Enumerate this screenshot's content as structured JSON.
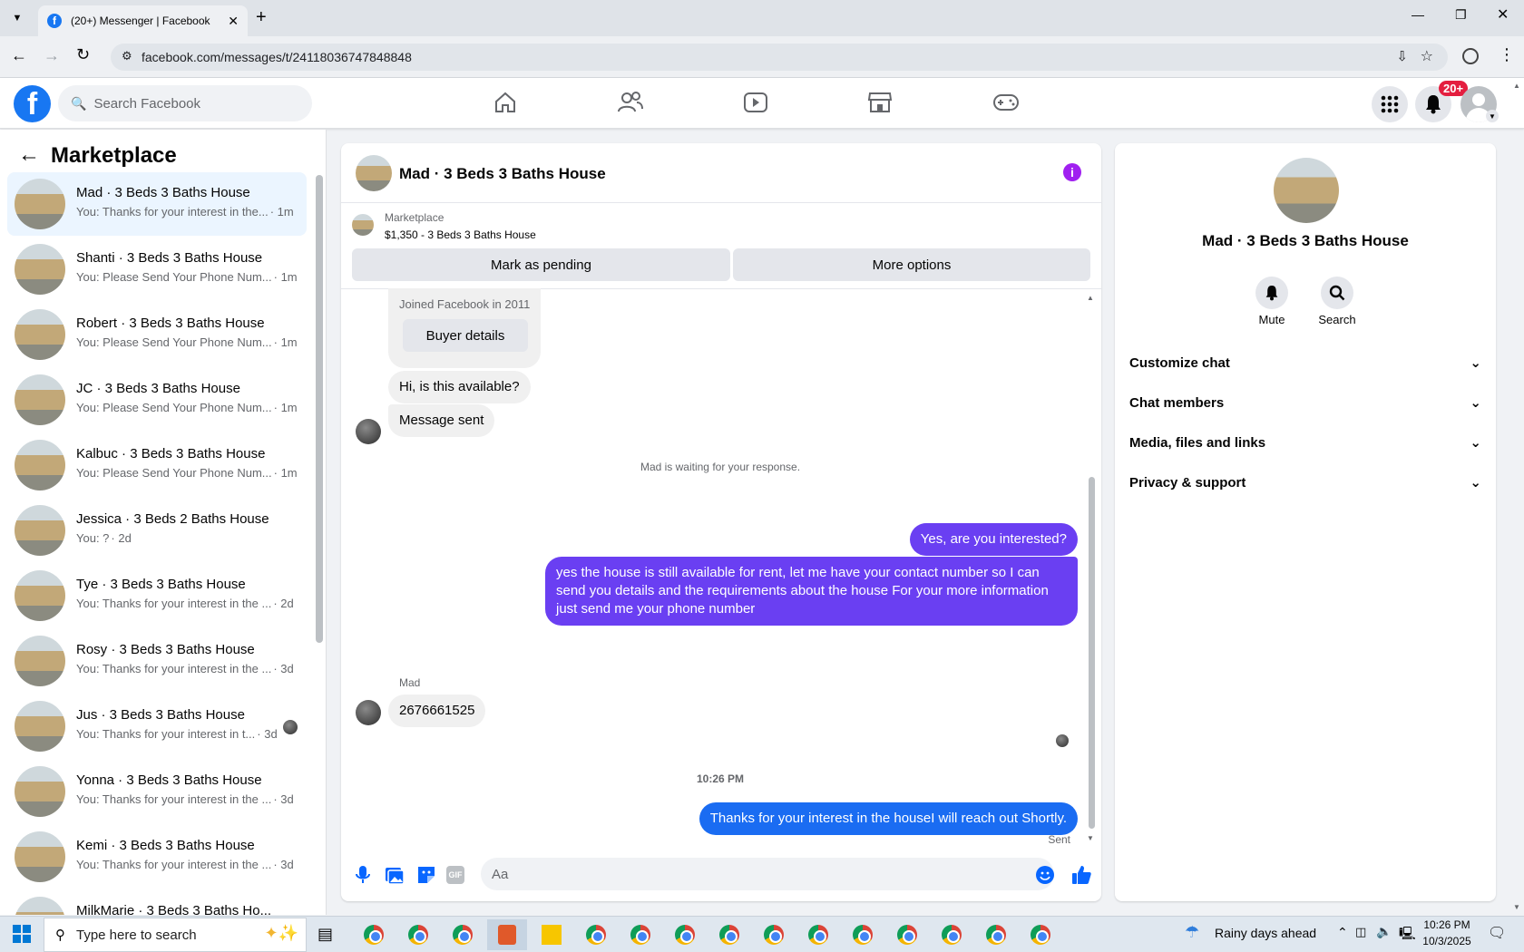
{
  "browser": {
    "tab_title": "(20+) Messenger | Facebook",
    "url": "facebook.com/messages/t/24118036747848848"
  },
  "header": {
    "search_placeholder": "Search Facebook",
    "notif_badge": "20+"
  },
  "sidebar": {
    "title": "Marketplace",
    "conversations": [
      {
        "title": "Mad · 3 Beds 3 Baths House",
        "snippet": "You: Thanks for your interest in the...",
        "time": "· 1m"
      },
      {
        "title": "Shanti · 3 Beds 3 Baths House",
        "snippet": "You: Please Send Your Phone Num...",
        "time": "· 1m"
      },
      {
        "title": "Robert · 3 Beds 3 Baths House",
        "snippet": "You: Please Send Your Phone Num...",
        "time": "· 1m"
      },
      {
        "title": "JC · 3 Beds 3 Baths House",
        "snippet": "You: Please Send Your Phone Num...",
        "time": "· 1m"
      },
      {
        "title": "Kalbuc · 3 Beds 3 Baths House",
        "snippet": "You: Please Send Your Phone Num...",
        "time": "· 1m"
      },
      {
        "title": "Jessica · 3 Beds 2 Baths House",
        "snippet": "You: ?",
        "time": "· 2d"
      },
      {
        "title": "Tye · 3 Beds 3 Baths House",
        "snippet": "You: Thanks for your interest in the ...",
        "time": "· 2d"
      },
      {
        "title": "Rosy · 3 Beds 3 Baths House",
        "snippet": "You: Thanks for your interest in the ...",
        "time": "· 3d"
      },
      {
        "title": "Jus · 3 Beds 3 Baths House",
        "snippet": "You: Thanks for your interest in t...",
        "time": "· 3d"
      },
      {
        "title": "Yonna · 3 Beds 3 Baths House",
        "snippet": "You: Thanks for your interest in the ...",
        "time": "· 3d"
      },
      {
        "title": "Kemi · 3 Beds 3 Baths House",
        "snippet": "You: Thanks for your interest in the ...",
        "time": "· 3d"
      },
      {
        "title": "MilkMarie · 3 Beds 3 Baths Ho...",
        "snippet": "",
        "time": ""
      }
    ]
  },
  "chat": {
    "title": "Mad · 3 Beds 3 Baths House",
    "listing_source": "Marketplace",
    "listing_text": "$1,350 - 3 Beds 3 Baths House",
    "mark_pending": "Mark as pending",
    "more_options": "More options",
    "joined": "Joined Facebook in 2011",
    "buyer_details": "Buyer details",
    "msg_available": "Hi, is this available?",
    "msg_sent": "Message sent",
    "waiting": "Mad is waiting for your response.",
    "out1": "Yes, are you interested?",
    "out2": "yes the house is still available for rent, let me have your contact number so I can send you details and the requirements about the house For  your  more  information  just  send  me   your  phone  number",
    "sender_name": "Mad",
    "in_number": "2676661525",
    "timestamp": "10:26 PM",
    "out3": "Thanks for your interest in the houseI will reach out Shortly.",
    "sent_status": "Sent",
    "composer_placeholder": "Aa"
  },
  "details": {
    "title": "Mad · 3 Beds 3 Baths House",
    "mute": "Mute",
    "search": "Search",
    "sections": [
      "Customize chat",
      "Chat members",
      "Media, files and links",
      "Privacy & support"
    ]
  },
  "taskbar": {
    "search_placeholder": "Type here to search",
    "weather": "Rainy days ahead",
    "time": "10:26 PM",
    "date": "10/3/2025"
  },
  "colors": {
    "fb_blue": "#1877f2",
    "outgoing_purple": "#6a3ff2",
    "outgoing_blue": "#1a6cf2",
    "info_purple": "#a020f0"
  }
}
